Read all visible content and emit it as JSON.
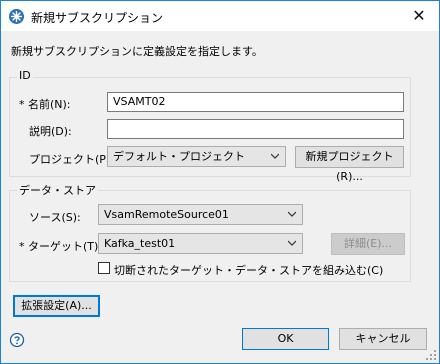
{
  "window": {
    "title": "新規サブスクリプション",
    "close_glyph": "✕",
    "app_icon": "wheel-icon"
  },
  "subtitle": "新規サブスクリプションに定義設定を指定します。",
  "id_group": {
    "title": "ID",
    "name_label": "* 名前(N):",
    "name_value": "VSAMT02",
    "description_label": "説明(D):",
    "description_value": "",
    "project_label": "プロジェクト(P):",
    "project_value": "デフォルト・プロジェクト",
    "new_project_button": "新規プロジェクト(R)..."
  },
  "datastore_group": {
    "title": "データ・ストア",
    "source_label": "ソース(S):",
    "source_value": "VsamRemoteSource01",
    "target_label": "* ターゲット(T):",
    "target_value": "Kafka_test01",
    "details_button": "詳細(E)...",
    "combine_checkbox_label": "切断されたターゲット・データ・ストアを組み込む(C)",
    "combine_checked": false
  },
  "buttons": {
    "advanced": "拡張設定(A)...",
    "ok": "OK",
    "cancel": "キャンセル"
  },
  "colors": {
    "accent": "#0078d7",
    "window_border": "#1883d7",
    "dialog_background": "#f0f0f0"
  }
}
